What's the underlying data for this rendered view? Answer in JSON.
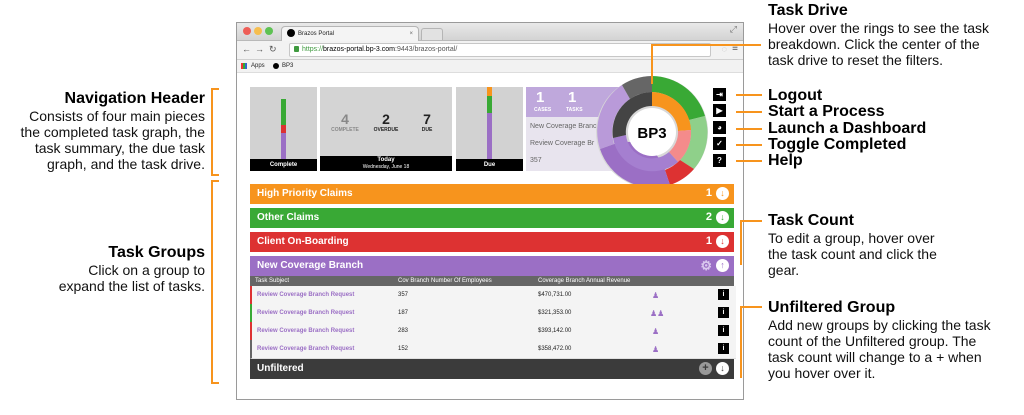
{
  "annotations": {
    "nav_header": {
      "title": "Navigation Header",
      "body": [
        "Consists of four main pieces",
        "the completed task graph, the",
        "task summary, the due task",
        "graph, and the task drive."
      ]
    },
    "task_groups": {
      "title": "Task Groups",
      "body": [
        "Click on a group to",
        "expand the list of tasks."
      ]
    },
    "task_drive": {
      "title": "Task Drive",
      "body": [
        "Hover over the rings to see the task",
        "breakdown. Click the center of the",
        "task drive to reset the filters."
      ]
    },
    "logout": "Logout",
    "start_process": "Start a Process",
    "launch_dashboard": "Launch a Dashboard",
    "toggle_completed": "Toggle Completed",
    "help": "Help",
    "task_count": {
      "title": "Task Count",
      "body": [
        "To edit a group, hover over",
        "the task count and click the",
        "gear."
      ]
    },
    "unfiltered_group": {
      "title": "Unfiltered Group",
      "body": [
        "Add new groups by clicking the task",
        "count of the Unfiltered group. The",
        "task count will change to a + when",
        "you hover over it."
      ]
    }
  },
  "browser": {
    "tab_title": "Brazos Portal",
    "url_prefix": "https://",
    "url_host": "brazos-portal.bp-3.com",
    "url_rest": ":9443/brazos-portal/",
    "bookmarks": [
      "Apps",
      "BP3"
    ]
  },
  "header": {
    "complete_label": "Complete",
    "summary": {
      "complete_value": "4",
      "complete_label": "COMPLETE",
      "overdue_value": "2",
      "overdue_label": "OVERDUE",
      "due_value": "7",
      "due_label": "DUE"
    },
    "today_label": "Today",
    "today_date": "Wednesday, June 18",
    "due_label": "Due",
    "drive_panel": {
      "cases_value": "1",
      "cases_label": "CASES",
      "tasks_value": "1",
      "tasks_label": "TASKS",
      "item1": "New Coverage Branch",
      "item2": "Review Coverage Br",
      "item3": "357"
    },
    "drive_logo": "BP3"
  },
  "groups": [
    {
      "name": "High Priority Claims",
      "count": "1",
      "color": "#f7941d"
    },
    {
      "name": "Other Claims",
      "count": "2",
      "color": "#39a935"
    },
    {
      "name": "Client On-Boarding",
      "count": "1",
      "color": "#dd3232"
    },
    {
      "name": "New Coverage Branch",
      "color": "#9b6fc5"
    }
  ],
  "table": {
    "headers": [
      "Task Subject",
      "Cov Branch Number Of Employees",
      "Coverage Branch Annual Revenue"
    ],
    "rows": [
      {
        "subject": "Review Coverage Branch Request",
        "employees": "357",
        "revenue": "$470,731.00"
      },
      {
        "subject": "Review Coverage Branch Request",
        "employees": "187",
        "revenue": "$321,353.00"
      },
      {
        "subject": "Review Coverage Branch Request",
        "employees": "283",
        "revenue": "$393,142.00"
      },
      {
        "subject": "Review Coverage Branch Request",
        "employees": "152",
        "revenue": "$358,472.00"
      }
    ]
  },
  "unfiltered": {
    "name": "Unfiltered"
  }
}
